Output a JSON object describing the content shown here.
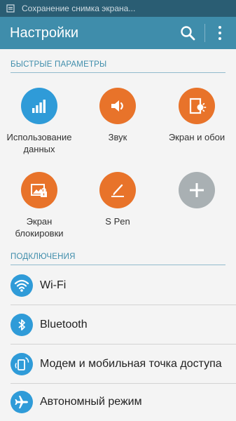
{
  "status_bar": {
    "notification_text": "Сохранение снимка экрана...",
    "notification_icon": "screenshot-icon"
  },
  "app_bar": {
    "title": "Настройки",
    "search_icon": "search-icon",
    "menu_icon": "more-vert-icon",
    "color": "#3f8dab"
  },
  "quick_settings": {
    "header": "БЫСТРЫЕ ПАРАМЕТРЫ",
    "items": [
      {
        "label": "Использование данных",
        "icon": "data-usage-icon",
        "color": "#2f9bd8"
      },
      {
        "label": "Звук",
        "icon": "volume-icon",
        "color": "#e8732a"
      },
      {
        "label": "Экран и обои",
        "icon": "display-wallpaper-icon",
        "color": "#e8732a"
      },
      {
        "label": "Экран блокировки",
        "icon": "lock-screen-icon",
        "color": "#e8732a"
      },
      {
        "label": "S Pen",
        "icon": "pen-icon",
        "color": "#e8732a"
      },
      {
        "label": "",
        "icon": "add-icon",
        "color": "#a9b0b3"
      }
    ]
  },
  "connections": {
    "header": "ПОДКЛЮЧЕНИЯ",
    "items": [
      {
        "label": "Wi-Fi",
        "icon": "wifi-icon"
      },
      {
        "label": "Bluetooth",
        "icon": "bluetooth-icon"
      },
      {
        "label": "Модем и мобильная точка доступа",
        "icon": "hotspot-icon"
      },
      {
        "label": "Автономный режим",
        "icon": "airplane-icon"
      }
    ]
  }
}
